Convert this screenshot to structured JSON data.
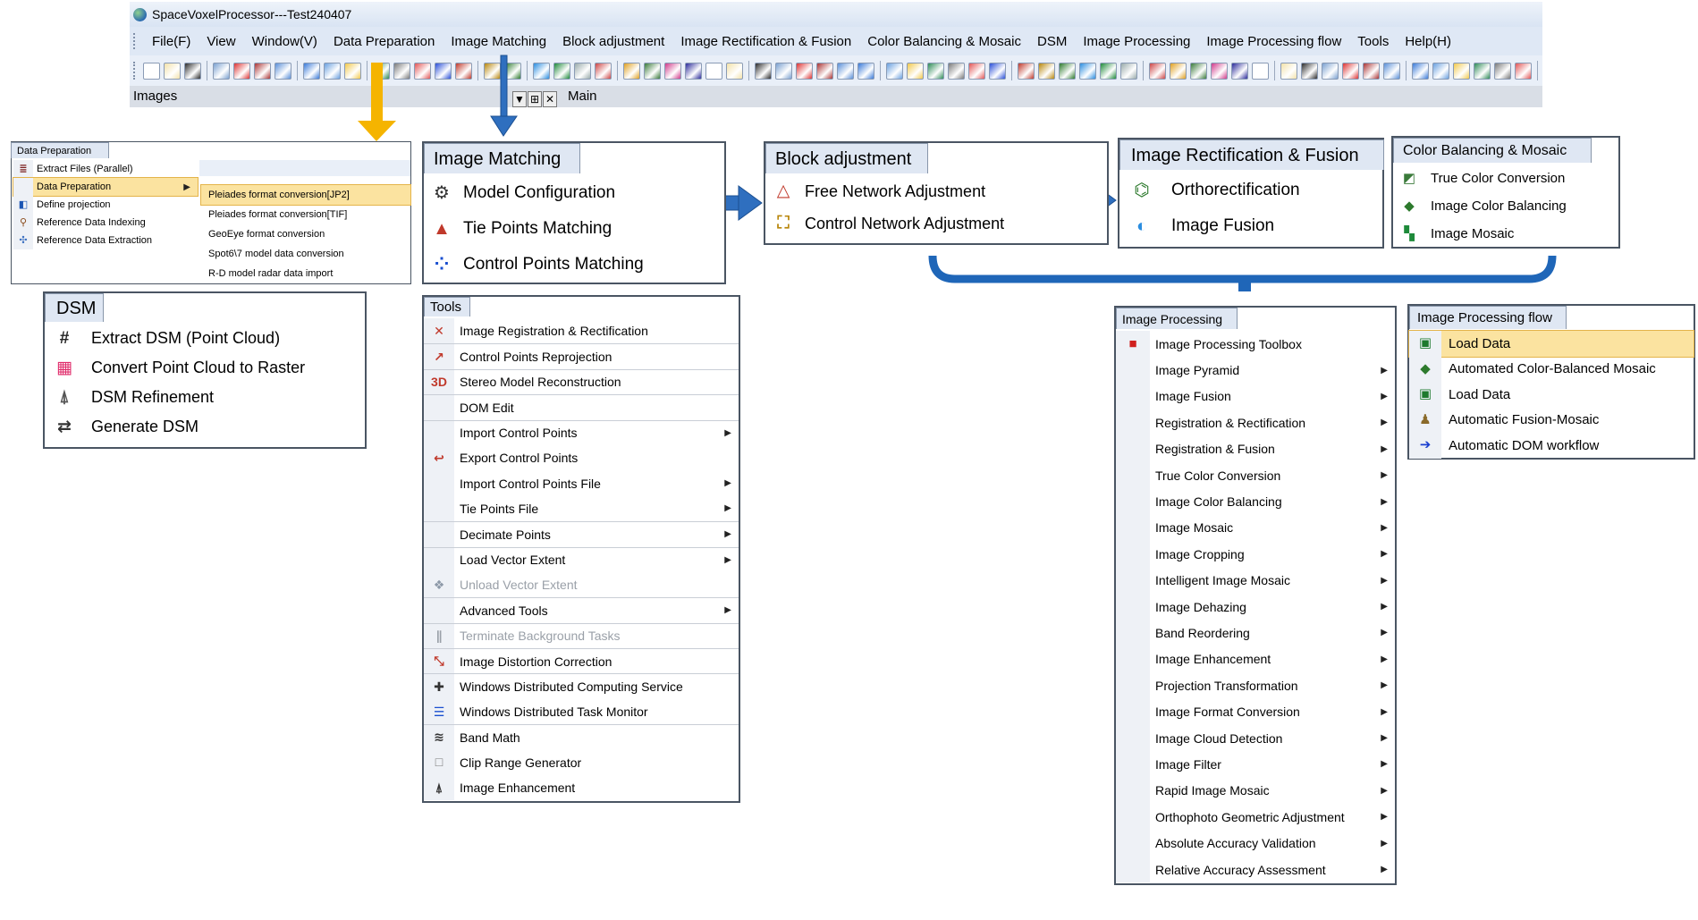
{
  "app": {
    "title": "SpaceVoxelProcessor---Test240407",
    "menu": [
      "File(F)",
      "View",
      "Window(V)",
      "Data Preparation",
      "Image Matching",
      "Block adjustment",
      "Image Rectification & Fusion",
      "Color Balancing & Mosaic",
      "DSM",
      "Image Processing",
      "Image Processing flow",
      "Tools",
      "Help(H)"
    ],
    "panel_label": "Images",
    "panel_buttons": [
      "▼",
      "⊞",
      "✕"
    ],
    "main_label": "Main"
  },
  "colors": {
    "arrow_orange": "#f5b400",
    "arrow_blue": "#2f6fbf",
    "bracket_blue": "#1f66b8",
    "highlight": "#fbe3a0",
    "panel_tab": "#dfe7f3"
  },
  "data_preparation": {
    "title": "Data Preparation",
    "items": [
      {
        "label": "Extract Files  (Parallel)",
        "icon": "extract-icon"
      },
      {
        "label": "Data Preparation",
        "icon": "",
        "submenu": true
      },
      {
        "label": "Define projection",
        "icon": "projection-icon"
      },
      {
        "label": "Reference Data Indexing",
        "icon": "indexing-icon"
      },
      {
        "label": "Reference Data Extraction",
        "icon": "extraction-icon"
      }
    ],
    "submenu": [
      "Pleiades format conversion[JP2]",
      "Pleiades format conversion[TIF]",
      "GeoEye format conversion",
      "Spot6\\7 model data conversion",
      "R-D model radar data import"
    ]
  },
  "image_matching": {
    "title": "Image Matching",
    "items": [
      {
        "label": "Model Configuration",
        "icon": "model-config-icon"
      },
      {
        "label": "Tie Points Matching",
        "icon": "tie-points-icon"
      },
      {
        "label": "Control Points Matching",
        "icon": "control-points-icon"
      }
    ]
  },
  "block_adjustment": {
    "title": "Block adjustment",
    "items": [
      {
        "label": "Free Network Adjustment",
        "icon": "triangle-icon"
      },
      {
        "label": "Control Network Adjustment",
        "icon": "control-network-icon"
      }
    ]
  },
  "rectification": {
    "title": "Image Rectification & Fusion",
    "items": [
      {
        "label": "Orthorectification",
        "icon": "ortho-icon"
      },
      {
        "label": "Image Fusion",
        "icon": "fusion-icon"
      }
    ]
  },
  "color_balancing": {
    "title": "Color Balancing & Mosaic",
    "items": [
      {
        "label": "True Color Conversion",
        "icon": "true-color-icon"
      },
      {
        "label": "Image Color Balancing",
        "icon": "balance-icon"
      },
      {
        "label": "Image Mosaic",
        "icon": "mosaic-icon"
      }
    ]
  },
  "dsm": {
    "title": "DSM",
    "items": [
      {
        "label": "Extract DSM  (Point Cloud)",
        "icon": "grid-icon"
      },
      {
        "label": "Convert Point Cloud to Raster",
        "icon": "raster-icon"
      },
      {
        "label": "DSM Refinement",
        "icon": "refine-icon"
      },
      {
        "label": "Generate DSM",
        "icon": "generate-icon"
      }
    ]
  },
  "tools": {
    "title": "Tools",
    "items": [
      {
        "label": "Image Registration & Rectification",
        "icon": "registration-icon",
        "arrow": false,
        "disabled": false,
        "sep": false
      },
      {
        "label": "Control Points Reprojection",
        "icon": "reprojection-icon",
        "arrow": false,
        "disabled": false,
        "sep": true
      },
      {
        "label": "Stereo Model Reconstruction",
        "icon": "stereo-3d-icon",
        "arrow": false,
        "disabled": false,
        "sep": true
      },
      {
        "label": "DOM Edit",
        "icon": "",
        "arrow": false,
        "disabled": false,
        "sep": true
      },
      {
        "label": "Import Control Points",
        "icon": "",
        "arrow": true,
        "disabled": false,
        "sep": true
      },
      {
        "label": "Export Control Points",
        "icon": "export-icon",
        "arrow": false,
        "disabled": false,
        "sep": false
      },
      {
        "label": "Import Control Points File",
        "icon": "",
        "arrow": true,
        "disabled": false,
        "sep": false
      },
      {
        "label": "Tie Points File",
        "icon": "",
        "arrow": true,
        "disabled": false,
        "sep": false
      },
      {
        "label": "Decimate Points",
        "icon": "",
        "arrow": true,
        "disabled": false,
        "sep": true
      },
      {
        "label": "Load Vector Extent",
        "icon": "",
        "arrow": true,
        "disabled": false,
        "sep": true
      },
      {
        "label": "Unload Vector Extent",
        "icon": "unload-icon",
        "arrow": false,
        "disabled": true,
        "sep": false
      },
      {
        "label": "Advanced Tools",
        "icon": "",
        "arrow": true,
        "disabled": false,
        "sep": true
      },
      {
        "label": "Terminate Background Tasks",
        "icon": "pause-icon",
        "arrow": false,
        "disabled": true,
        "sep": true
      },
      {
        "label": "Image Distortion Correction",
        "icon": "distortion-icon",
        "arrow": false,
        "disabled": false,
        "sep": true
      },
      {
        "label": "Windows Distributed Computing Service",
        "icon": "distributed-icon",
        "arrow": false,
        "disabled": false,
        "sep": true
      },
      {
        "label": "Windows Distributed Task Monitor",
        "icon": "monitor-icon",
        "arrow": false,
        "disabled": false,
        "sep": false
      },
      {
        "label": "Band Math",
        "icon": "band-math-icon",
        "arrow": false,
        "disabled": false,
        "sep": true
      },
      {
        "label": "Clip Range Generator",
        "icon": "clip-icon",
        "arrow": false,
        "disabled": false,
        "sep": false
      },
      {
        "label": "Image Enhancement",
        "icon": "enhance-icon",
        "arrow": false,
        "disabled": false,
        "sep": false
      }
    ]
  },
  "image_processing": {
    "title": "Image Processing",
    "items": [
      {
        "label": "Image Processing Toolbox",
        "arrow": false
      },
      {
        "label": "Image Pyramid",
        "arrow": true
      },
      {
        "label": "Image Fusion",
        "arrow": true
      },
      {
        "label": "Registration & Rectification",
        "arrow": true
      },
      {
        "label": "Registration & Fusion",
        "arrow": true
      },
      {
        "label": "True Color Conversion",
        "arrow": true
      },
      {
        "label": "Image Color Balancing",
        "arrow": true
      },
      {
        "label": "Image Mosaic",
        "arrow": true
      },
      {
        "label": "Image Cropping",
        "arrow": true
      },
      {
        "label": "Intelligent Image Mosaic",
        "arrow": true
      },
      {
        "label": "Image Dehazing",
        "arrow": true
      },
      {
        "label": "Band Reordering",
        "arrow": true
      },
      {
        "label": "Image Enhancement",
        "arrow": true
      },
      {
        "label": "Projection Transformation",
        "arrow": true
      },
      {
        "label": "Image Format Conversion",
        "arrow": true
      },
      {
        "label": "Image Cloud Detection",
        "arrow": true
      },
      {
        "label": "Image Filter",
        "arrow": true
      },
      {
        "label": "Rapid Image Mosaic",
        "arrow": true
      },
      {
        "label": "Orthophoto Geometric Adjustment",
        "arrow": true
      },
      {
        "label": "Absolute Accuracy Validation",
        "arrow": true
      },
      {
        "label": "Relative Accuracy Assessment",
        "arrow": true
      }
    ]
  },
  "processing_flow": {
    "title": "Image Processing flow",
    "items": [
      {
        "label": "Load Data",
        "icon": "load-data-icon"
      },
      {
        "label": "Automated Color-Balanced Mosaic",
        "icon": "auto-mosaic-icon"
      },
      {
        "label": "Load Data",
        "icon": "load-data-icon"
      },
      {
        "label": "Automatic Fusion-Mosaic",
        "icon": "fusion-mosaic-icon"
      },
      {
        "label": "Automatic DOM workflow",
        "icon": "arrow-right-icon"
      }
    ]
  }
}
